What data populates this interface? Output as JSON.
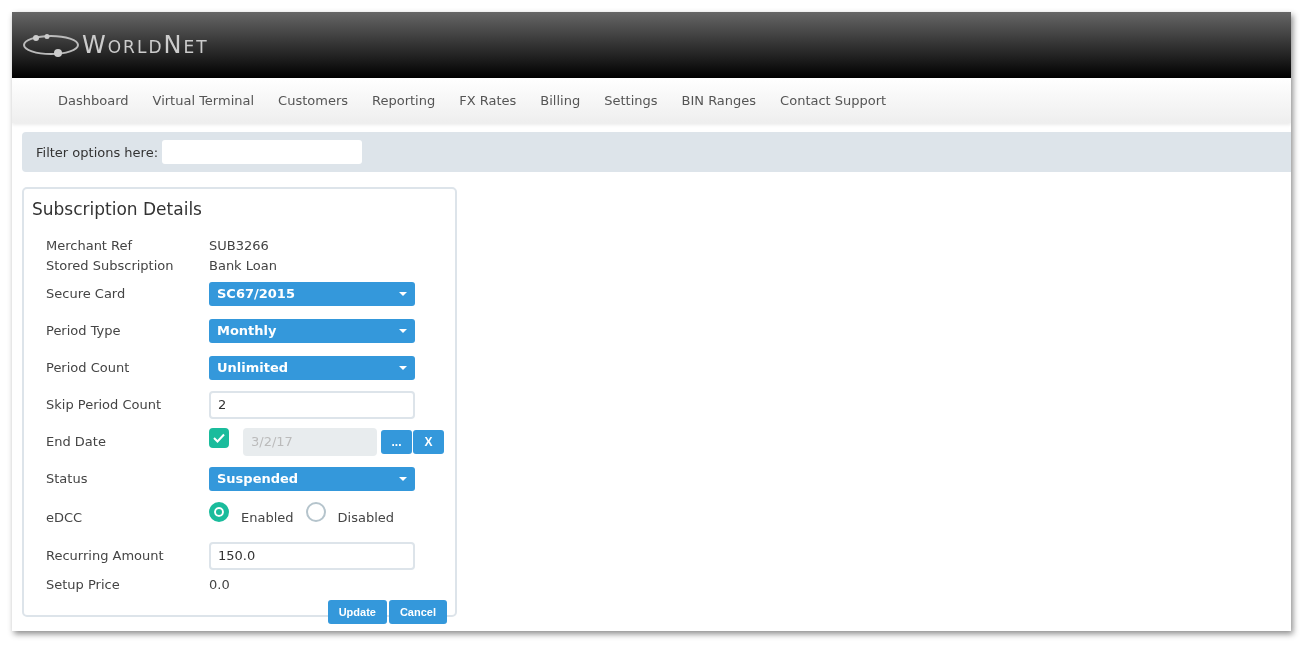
{
  "brand": {
    "name": "WorldNet"
  },
  "nav": [
    {
      "label": "Dashboard"
    },
    {
      "label": "Virtual Terminal"
    },
    {
      "label": "Customers"
    },
    {
      "label": "Reporting"
    },
    {
      "label": "FX Rates"
    },
    {
      "label": "Billing"
    },
    {
      "label": "Settings"
    },
    {
      "label": "BIN Ranges"
    },
    {
      "label": "Contact Support"
    }
  ],
  "filter": {
    "label": "Filter options here:"
  },
  "panel": {
    "title": "Subscription Details",
    "fields": [
      {
        "label": "Merchant Ref",
        "kind": "text",
        "value": "SUB3266"
      },
      {
        "label": "Stored Subscription",
        "kind": "text",
        "value": "Bank Loan"
      },
      {
        "label": "Secure Card",
        "kind": "select",
        "value": "SC67/2015"
      },
      {
        "label": "Period Type",
        "kind": "select",
        "value": "Monthly"
      },
      {
        "label": "Period Count",
        "kind": "select",
        "value": "Unlimited"
      },
      {
        "label": "Skip Period Count",
        "kind": "input",
        "value": "2"
      },
      {
        "label": "End Date",
        "kind": "date",
        "checked": true,
        "value": "3/2/17",
        "buttons": [
          "...",
          "X"
        ]
      },
      {
        "label": "Status",
        "kind": "select",
        "value": "Suspended"
      },
      {
        "label": "eDCC",
        "kind": "radio",
        "options": [
          {
            "label": "Enabled",
            "selected": true
          },
          {
            "label": "Disabled",
            "selected": false
          }
        ]
      },
      {
        "label": "Recurring Amount",
        "kind": "input",
        "value": "150.0"
      },
      {
        "label": "Setup Price",
        "kind": "text",
        "value": "0.0"
      }
    ],
    "buttons": [
      "Update",
      "Cancel"
    ]
  }
}
